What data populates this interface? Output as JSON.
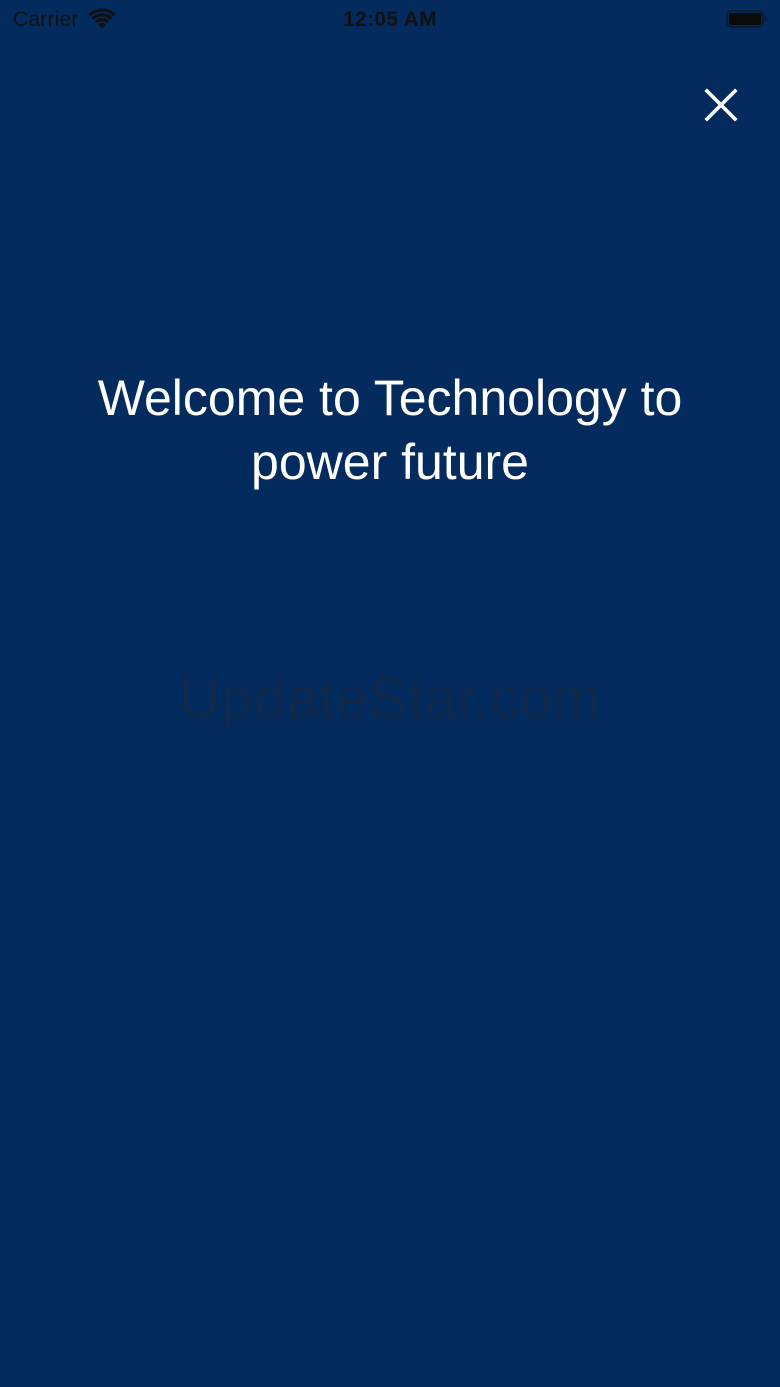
{
  "status_bar": {
    "carrier": "Carrier",
    "time": "12:05 AM",
    "wifi_icon": "wifi-icon",
    "battery_icon": "battery-icon"
  },
  "close_button": {
    "icon": "close-icon"
  },
  "welcome": {
    "title": "Welcome to Technology to power future"
  },
  "watermark": {
    "text": "UpdateStar.com"
  },
  "colors": {
    "background": "#032b5d",
    "title_text": "#ffffff",
    "status_text": "#111111"
  }
}
